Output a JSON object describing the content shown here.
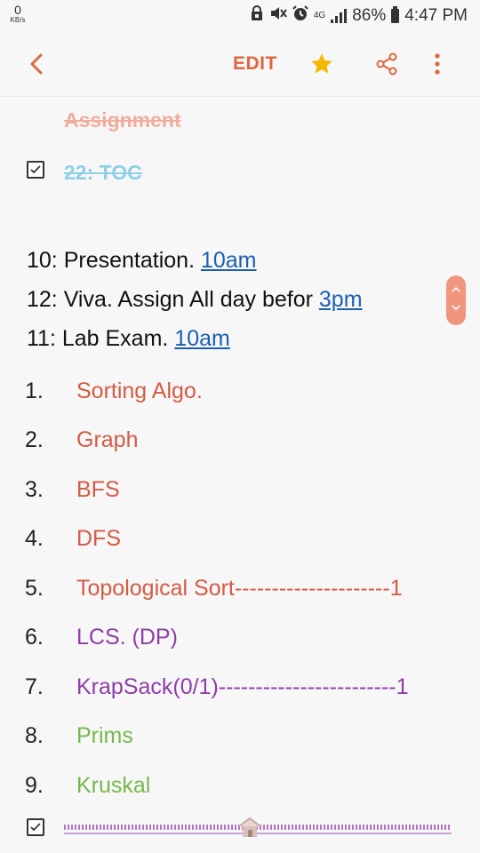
{
  "status_bar": {
    "data_speed": "0",
    "data_unit": "KB/s",
    "network": "4G",
    "battery": "86%",
    "time": "4:47 PM"
  },
  "app_bar": {
    "edit_label": "EDIT",
    "icons": [
      "back-arrow-icon",
      "star-icon",
      "share-icon",
      "more-options-icon"
    ],
    "accent_color": "#e2643f",
    "star_color": "#f5b800"
  },
  "note": {
    "struck_heading": "Assignment",
    "checked_item": "22: TOC",
    "schedule": [
      {
        "text": "10: Presentation. ",
        "time": "10am"
      },
      {
        "text": "12: Viva. Assign All day befor ",
        "time": "3pm"
      },
      {
        "text": "11: Lab Exam.  ",
        "time": "10am"
      }
    ],
    "list": [
      {
        "num": "1.",
        "text": "Sorting Algo.",
        "color": "red"
      },
      {
        "num": "2.",
        "text": "Graph",
        "color": "red"
      },
      {
        "num": "3.",
        "text": "BFS",
        "color": "red"
      },
      {
        "num": "4.",
        "text": "DFS",
        "color": "red"
      },
      {
        "num": "5.",
        "text": "Topological Sort---------------------1",
        "color": "red"
      },
      {
        "num": "6.",
        "text": "LCS. (DP)",
        "color": "purple"
      },
      {
        "num": "7.",
        "text": "KrapSack(0/1)------------------------1",
        "color": "purple"
      },
      {
        "num": "8.",
        "text": "Prims",
        "color": "green"
      },
      {
        "num": "9.",
        "text": "Kruskal",
        "color": "green"
      }
    ],
    "colors": {
      "red": "#d45a44",
      "purple": "#8e3ca8",
      "green": "#76b84b",
      "link": "#1a5fb4"
    }
  }
}
